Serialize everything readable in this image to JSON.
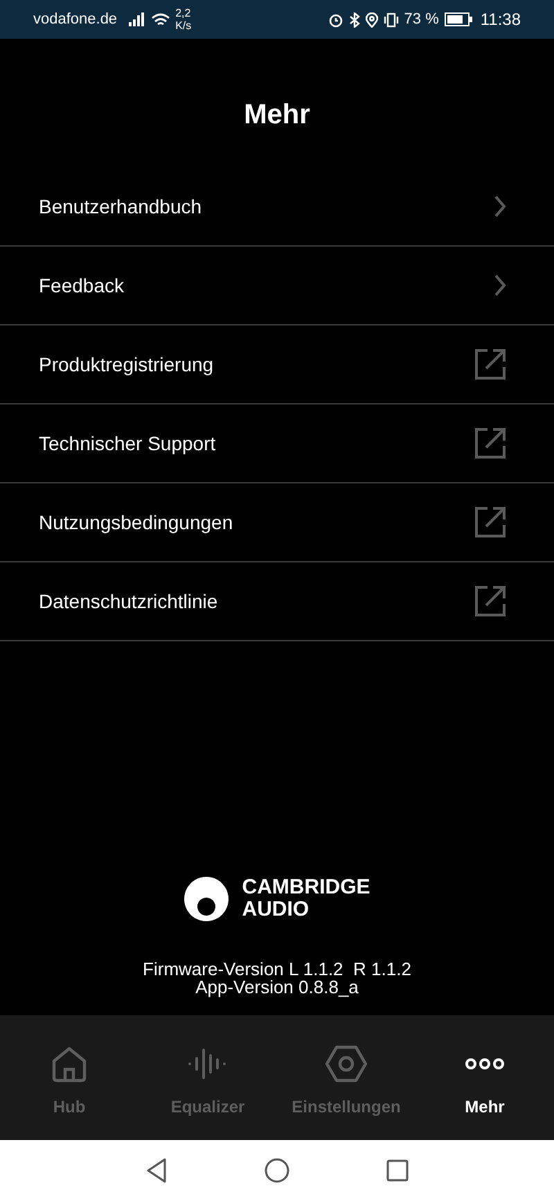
{
  "status_bar": {
    "carrier": "vodafone.de",
    "speed_value": "2,2",
    "speed_unit": "K/s",
    "battery": "73 %",
    "time": "11:38"
  },
  "title": "Mehr",
  "menu": [
    {
      "label": "Benutzerhandbuch",
      "kind": "chevron"
    },
    {
      "label": "Feedback",
      "kind": "chevron"
    },
    {
      "label": "Produktregistrierung",
      "kind": "external"
    },
    {
      "label": "Technischer Support",
      "kind": "external"
    },
    {
      "label": "Nutzungsbedingungen",
      "kind": "external"
    },
    {
      "label": "Datenschutzrichtlinie",
      "kind": "external"
    }
  ],
  "logo": {
    "line_1": "CAMBRIDGE",
    "line_2": "AUDIO"
  },
  "versions": [
    "Firmware-Version L 1.1.2  R 1.1.2",
    "App-Version 0.8.8_a"
  ],
  "tabs": [
    {
      "label": "Hub",
      "kind": "home",
      "selected": false
    },
    {
      "label": "Equalizer",
      "kind": "equalizer",
      "selected": false
    },
    {
      "label": "Einstellungen",
      "kind": "settings",
      "selected": false
    },
    {
      "label": "Mehr",
      "kind": "more",
      "selected": true
    }
  ]
}
